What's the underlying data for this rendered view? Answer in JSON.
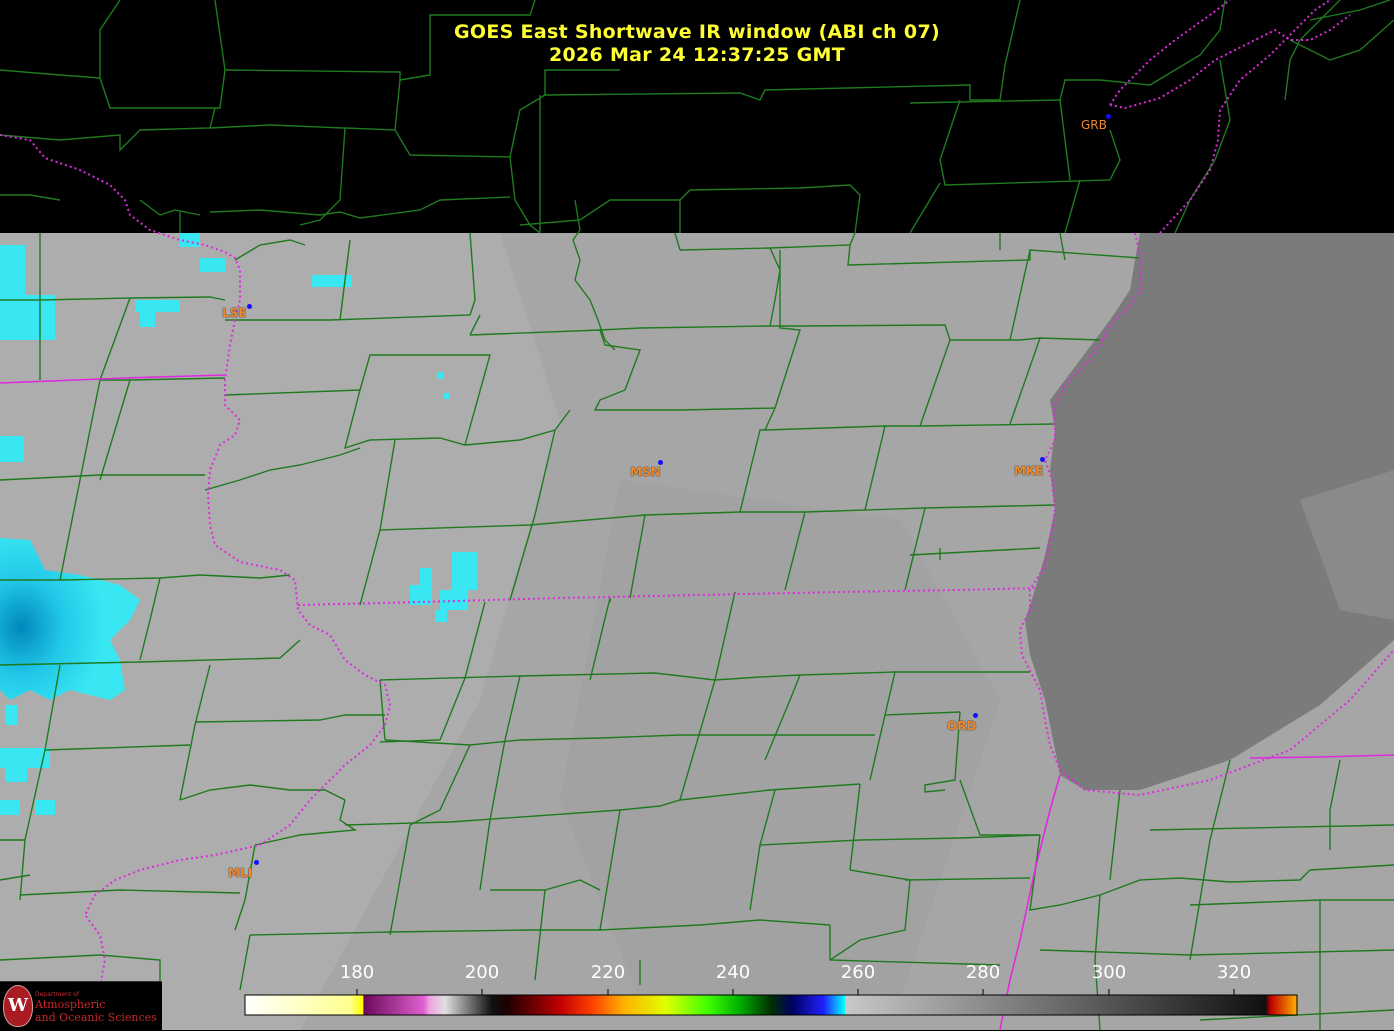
{
  "title": {
    "line1": "GOES East Shortwave IR window (ABI ch 07)",
    "line2": "2026 Mar 24  12:37:25 GMT"
  },
  "stations": [
    {
      "code": "GRB"
    },
    {
      "code": "LSE"
    },
    {
      "code": "MSN"
    },
    {
      "code": "MKE"
    },
    {
      "code": "ORD"
    },
    {
      "code": "MLI"
    }
  ],
  "colorbar": {
    "ticks": [
      "180",
      "200",
      "220",
      "240",
      "260",
      "280",
      "300",
      "320"
    ]
  },
  "logo": {
    "line_dept": "Department of",
    "line1": "Atmospheric",
    "line2": "and Oceanic Sciences",
    "seal_letter": "W"
  },
  "colors": {
    "title": "#ffff33",
    "county_lines": "#1f7a1f",
    "state_lines": "#e02ae0",
    "station_label": "#f08a2c",
    "station_marker": "#1010ff",
    "cloud_cyan": "#33e6f2",
    "lake": "#7a7a7a",
    "land": "#a9a9a9"
  }
}
